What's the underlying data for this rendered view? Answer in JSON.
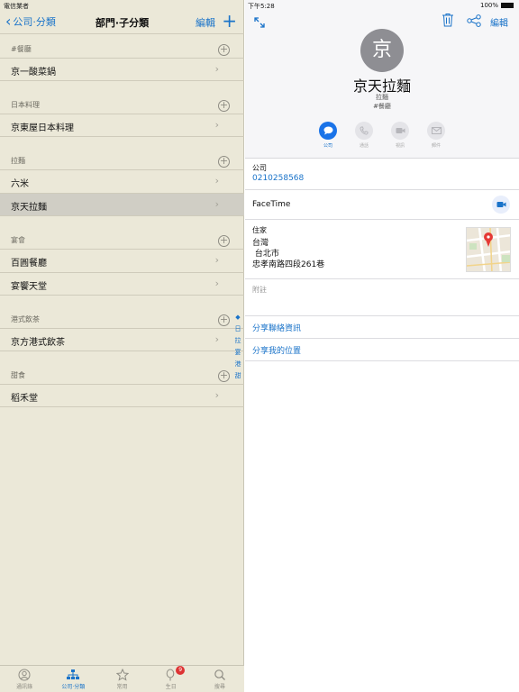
{
  "left_status": {
    "carrier": "電信業者"
  },
  "left_nav": {
    "back_label": "公司·分類",
    "title": "部門·子分類",
    "edit_label": "編輯",
    "add_label": "+"
  },
  "sections": [
    {
      "title": "#餐廳",
      "rows": [
        "京一酸菜鍋"
      ]
    },
    {
      "title": "日本料理",
      "rows": [
        "京東屋日本料理"
      ]
    },
    {
      "title": "拉麵",
      "rows": [
        "六米",
        "京天拉麵"
      ]
    },
    {
      "title": "宴會",
      "rows": [
        "百圓餐廳",
        "宴饗天堂"
      ]
    },
    {
      "title": "港式飲茶",
      "rows": [
        "京方港式飲茶"
      ]
    },
    {
      "title": "甜食",
      "rows": [
        "稻禾堂"
      ]
    }
  ],
  "selected_row": "京天拉麵",
  "index_letters": [
    "◆",
    "日",
    "拉",
    "宴",
    "港",
    "甜"
  ],
  "tabs": [
    {
      "label": "通訊錄",
      "icon": "person-icon"
    },
    {
      "label": "公司·分類",
      "icon": "org-chart-icon",
      "active": true
    },
    {
      "label": "常用",
      "icon": "star-icon"
    },
    {
      "label": "生日",
      "icon": "balloon-icon",
      "badge": "9"
    },
    {
      "label": "搜尋",
      "icon": "search-icon"
    }
  ],
  "right_status": {
    "time": "下午5:28",
    "battery": "100%"
  },
  "contact": {
    "initial": "京",
    "name": "京天拉麵",
    "department": "拉麵",
    "company": "#餐廳"
  },
  "actions": [
    {
      "label": "公司",
      "icon": "message-icon",
      "active": true
    },
    {
      "label": "通話",
      "icon": "phone-icon"
    },
    {
      "label": "視訊",
      "icon": "video-icon"
    },
    {
      "label": "郵件",
      "icon": "mail-icon"
    }
  ],
  "right_toolbar": {
    "edit_label": "編輯"
  },
  "phone": {
    "label": "公司",
    "value": "0210258568"
  },
  "facetime": {
    "label": "FaceTime"
  },
  "address": {
    "label": "住家",
    "line1": "台灣",
    "line2": " 台北市",
    "line3": "忠孝南路四段261巷"
  },
  "notes": {
    "label": "附註"
  },
  "links": [
    "分享聯絡資訊",
    "分享我的位置"
  ],
  "colors": {
    "accent": "#1a73c9",
    "left_bg": "#ebe8d8",
    "selected_row_bg": "#d0cec5",
    "badge": "#dd3333"
  }
}
